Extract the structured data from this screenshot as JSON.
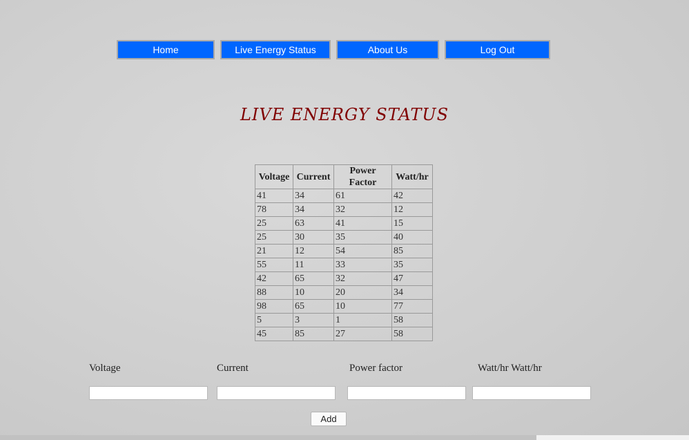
{
  "nav": {
    "home": "Home",
    "live": "Live Energy Status",
    "about": "About Us",
    "logout": "Log Out"
  },
  "page_title": "LIVE ENERGY STATUS",
  "table": {
    "headers": [
      "Voltage",
      "Current",
      "Power Factor",
      "Watt/hr"
    ],
    "rows": [
      [
        "41",
        "34",
        "61",
        "42"
      ],
      [
        "78",
        "34",
        "32",
        "12"
      ],
      [
        "25",
        "63",
        "41",
        "15"
      ],
      [
        "25",
        "30",
        "35",
        "40"
      ],
      [
        "21",
        "12",
        "54",
        "85"
      ],
      [
        "55",
        "11",
        "33",
        "35"
      ],
      [
        "42",
        "65",
        "32",
        "47"
      ],
      [
        "88",
        "10",
        "20",
        "34"
      ],
      [
        "98",
        "65",
        "10",
        "77"
      ],
      [
        "5",
        "3",
        "1",
        "58"
      ],
      [
        "45",
        "85",
        "27",
        "58"
      ]
    ]
  },
  "form": {
    "voltage_label": "Voltage",
    "current_label": "Current",
    "power_factor_label": "Power factor",
    "watt_label": "Watt/hr Watt/hr",
    "voltage_value": "",
    "current_value": "",
    "power_factor_value": "",
    "watt_value": "",
    "add_label": "Add"
  },
  "colors": {
    "nav_bg": "#0066ff",
    "title": "#800000"
  }
}
